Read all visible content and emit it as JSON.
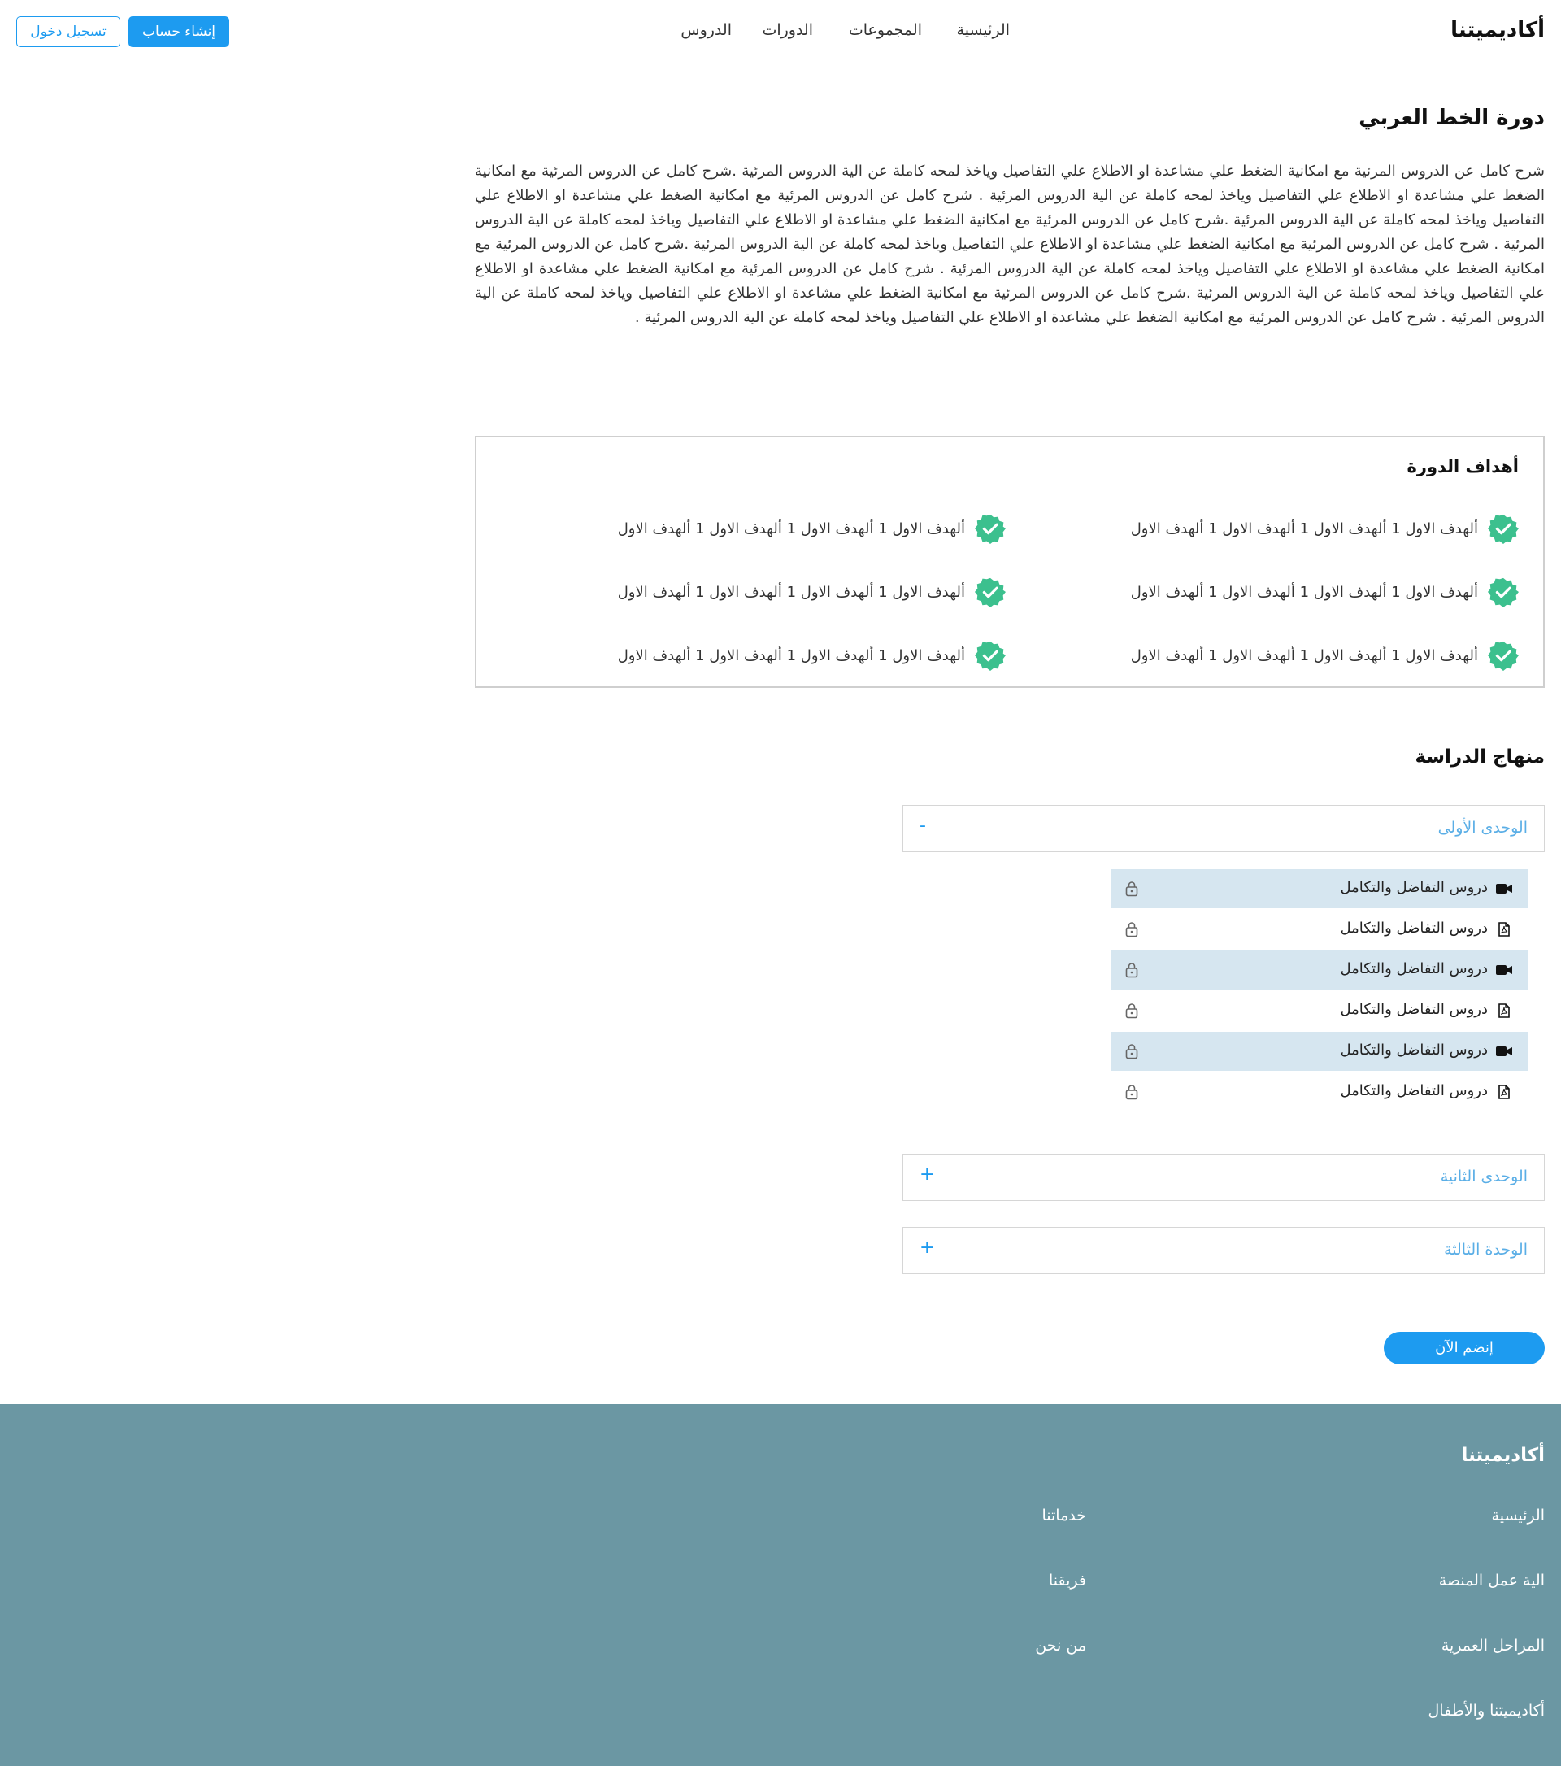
{
  "header": {
    "logo": "أكاديميتنا",
    "nav": [
      {
        "label": "الرئيسية"
      },
      {
        "label": "المجموعات"
      },
      {
        "label": "الدورات"
      },
      {
        "label": "الدروس"
      }
    ],
    "register_label": "إنشاء حساب",
    "login_label": "تسجيل دخول"
  },
  "course": {
    "title": "دورة الخط العربي",
    "description": "شرح كامل عن الدروس المرئية مع امكانية الضغط علي مشاعدة او الاطلاع علي التفاصيل وياخذ لمحه كاملة عن الية الدروس المرئية .شرح كامل عن الدروس المرئية مع امكانية الضغط علي مشاعدة او الاطلاع علي التفاصيل وياخذ لمحه كاملة عن الية الدروس المرئية . شرح كامل عن الدروس المرئية مع امكانية الضغط علي مشاعدة او الاطلاع علي التفاصيل وياخذ لمحه كاملة عن الية الدروس المرئية .شرح كامل عن الدروس المرئية مع امكانية الضغط علي مشاعدة او الاطلاع علي التفاصيل وياخذ لمحه كاملة عن الية الدروس المرئية . شرح كامل عن الدروس المرئية مع امكانية الضغط علي مشاعدة او الاطلاع علي التفاصيل وياخذ لمحه كاملة عن الية الدروس المرئية .شرح كامل عن الدروس المرئية مع امكانية الضغط علي مشاعدة او الاطلاع علي التفاصيل وياخذ لمحه كاملة عن الية الدروس المرئية . شرح كامل عن الدروس المرئية مع امكانية الضغط علي مشاعدة او الاطلاع علي التفاصيل وياخذ لمحه كاملة عن الية الدروس المرئية .شرح كامل عن الدروس المرئية مع امكانية الضغط علي مشاعدة او الاطلاع علي التفاصيل وياخذ لمحه كاملة عن الية الدروس المرئية . شرح كامل عن الدروس المرئية مع امكانية الضغط علي مشاعدة او الاطلاع علي التفاصيل وياخذ لمحه كاملة عن الية الدروس المرئية ."
  },
  "goals": {
    "title": "أهداف الدورة",
    "items": [
      "ألهدف الاول 1 ألهدف الاول 1 ألهدف الاول 1 ألهدف الاول",
      "ألهدف الاول 1 ألهدف الاول 1 ألهدف الاول 1 ألهدف الاول",
      "ألهدف الاول 1 ألهدف الاول 1 ألهدف الاول 1 ألهدف الاول",
      "ألهدف الاول 1 ألهدف الاول 1 ألهدف الاول 1 ألهدف الاول",
      "ألهدف الاول 1 ألهدف الاول 1 ألهدف الاول 1 ألهدف الاول",
      "ألهدف الاول 1 ألهدف الاول 1 ألهدف الاول 1 ألهدف الاول"
    ],
    "icon": "verified-badge-icon",
    "icon_color": "#3cc08e"
  },
  "curriculum": {
    "title": "منهاج الدراسة",
    "units": [
      {
        "title": "الوحدى الأولى",
        "toggle": "-"
      },
      {
        "title": "الوحدى الثانية",
        "toggle": "+"
      },
      {
        "title": "الوحدة الثالثة",
        "toggle": "+"
      }
    ],
    "lessons": [
      {
        "title": "دروس التفاضل والتكامل",
        "type": "video-icon"
      },
      {
        "title": "دروس التفاضل والتكامل",
        "type": "pdf-icon"
      },
      {
        "title": "دروس التفاضل والتكامل",
        "type": "video-icon"
      },
      {
        "title": "دروس التفاضل والتكامل",
        "type": "pdf-icon"
      },
      {
        "title": "دروس التفاضل والتكامل",
        "type": "video-icon"
      },
      {
        "title": "دروس التفاضل والتكامل",
        "type": "pdf-icon"
      }
    ]
  },
  "join_label": "إنضم الآن",
  "footer": {
    "logo": "أكاديميتنا",
    "links": [
      "الرئيسية",
      "الية عمل المنصة",
      "المراحل العمرية",
      "أكاديميتنا والأطفال",
      "خدماتنا",
      "فريقنا",
      "من نحن"
    ],
    "background": "#6b97a3"
  },
  "colors": {
    "accent": "#1d9bf0",
    "lesson_highlight": "#d6e6f0",
    "unit_title": "#5aaee6"
  }
}
